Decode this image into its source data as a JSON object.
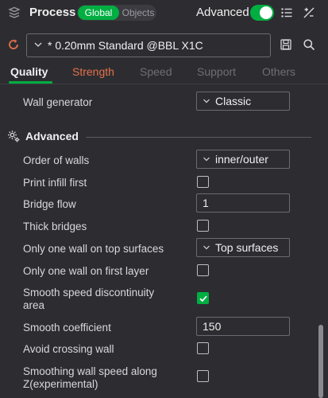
{
  "header": {
    "title": "Process",
    "scope_global": "Global",
    "scope_objects": "Objects",
    "advanced_label": "Advanced",
    "advanced_on": true
  },
  "preset": {
    "value": "* 0.20mm Standard @BBL X1C"
  },
  "tabs": [
    {
      "label": "Quality",
      "active": true
    },
    {
      "label": "Strength",
      "modified": true
    },
    {
      "label": "Speed"
    },
    {
      "label": "Support"
    },
    {
      "label": "Others"
    }
  ],
  "settings": {
    "wall_generator": {
      "label": "Wall generator",
      "value": "Classic"
    },
    "advanced_section": "Advanced",
    "order_of_walls": {
      "label": "Order of walls",
      "value": "inner/outer"
    },
    "print_infill_first": {
      "label": "Print infill first",
      "checked": false
    },
    "bridge_flow": {
      "label": "Bridge flow",
      "value": "1"
    },
    "thick_bridges": {
      "label": "Thick bridges",
      "checked": false
    },
    "one_wall_top": {
      "label": "Only one wall on top surfaces",
      "value": "Top surfaces"
    },
    "one_wall_first": {
      "label": "Only one wall on first layer",
      "checked": false
    },
    "smooth_speed": {
      "label_line1": "Smooth speed discontinuity",
      "label_line2": "area",
      "checked": true
    },
    "smooth_coefficient": {
      "label": "Smooth coefficient",
      "value": "150"
    },
    "avoid_crossing": {
      "label": "Avoid crossing wall",
      "checked": false
    },
    "smoothing_wall_speed": {
      "label_line1": "Smoothing wall speed along",
      "label_line2": "Z(experimental)",
      "checked": false
    }
  },
  "colors": {
    "accent": "#00ae42",
    "modified_tab": "#e5704a",
    "background": "#2d2d31"
  },
  "icons": [
    "layers-icon",
    "list-icon",
    "compare-icon",
    "sync-icon",
    "chevron-down-icon",
    "save-icon",
    "search-icon",
    "gear-icon",
    "check-icon"
  ]
}
